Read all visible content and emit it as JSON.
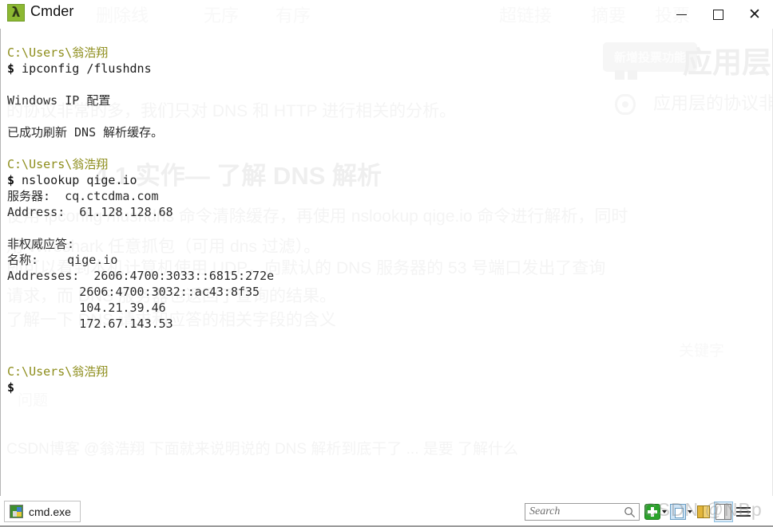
{
  "window": {
    "title": "Cmder",
    "app_icon": "lambda-icon",
    "controls": {
      "minimize": "minimize-icon",
      "maximize": "maximize-icon",
      "close": "close-icon"
    }
  },
  "terminal": {
    "lines": [
      {
        "type": "prompt",
        "text": "C:\\Users\\翁浩翔"
      },
      {
        "type": "command",
        "sigil": "$",
        "text": " ipconfig /flushdns"
      },
      {
        "type": "blank",
        "text": ""
      },
      {
        "type": "output",
        "text": "Windows IP 配置"
      },
      {
        "type": "blank",
        "text": ""
      },
      {
        "type": "output",
        "text": "已成功刷新 DNS 解析缓存。"
      },
      {
        "type": "blank",
        "text": ""
      },
      {
        "type": "prompt",
        "text": "C:\\Users\\翁浩翔"
      },
      {
        "type": "command",
        "sigil": "$",
        "text": " nslookup qige.io"
      },
      {
        "type": "output",
        "text": "服务器:  cq.ctcdma.com"
      },
      {
        "type": "output",
        "text": "Address:  61.128.128.68"
      },
      {
        "type": "blank",
        "text": ""
      },
      {
        "type": "output",
        "text": "非权威应答:"
      },
      {
        "type": "output",
        "text": "名称:    qige.io"
      },
      {
        "type": "output",
        "text": "Addresses:  2606:4700:3033::6815:272e"
      },
      {
        "type": "output",
        "text": "          2606:4700:3032::ac43:8f35"
      },
      {
        "type": "output",
        "text": "          104.21.39.46"
      },
      {
        "type": "output",
        "text": "          172.67.143.53"
      },
      {
        "type": "blank",
        "text": ""
      },
      {
        "type": "blank",
        "text": ""
      },
      {
        "type": "prompt",
        "text": "C:\\Users\\翁浩翔"
      },
      {
        "type": "command",
        "sigil": "$",
        "text": ""
      }
    ],
    "colors": {
      "prompt": "#8d8d1b",
      "sigil": "#0b0b0b",
      "command": "#1b1b1b",
      "output": "#2a2a2a",
      "background": "#ffffff"
    }
  },
  "statusbar": {
    "tab": {
      "label": "cmd.exe",
      "icon": "console-icon"
    },
    "search": {
      "placeholder": "Search",
      "value": "",
      "icon": "search-icon"
    },
    "tools": [
      {
        "name": "new-console-button",
        "icon": "green-plus-icon",
        "has_caret": true
      },
      {
        "name": "copy-paste-button",
        "icon": "page-icon",
        "has_caret": true
      },
      {
        "name": "lock-button",
        "icon": "lock-icon",
        "has_caret": false
      },
      {
        "name": "toggle-panel-button",
        "icon": "panel-icon",
        "has_caret": false
      },
      {
        "name": "menu-button",
        "icon": "hamburger-menu-icon",
        "has_caret": false
      }
    ],
    "watermark": "CSDN @NBp"
  },
  "background_bleed": {
    "chip": "新增投票功能",
    "toolbar_labels": [
      "删除线",
      "无序",
      "有序",
      "超链接",
      "摘要",
      "投票"
    ],
    "heading_partial": "应用层",
    "subtext_partial": "应用层的协议非常",
    "heading_41": "4.1 实作— 了解 DNS 解析",
    "line_a": "的协议非常的多，我们只对 DNS 和 HTTP 进行相关的分析。",
    "line_b": "使用 ipconfig /flushdns 命令清除缓存，再使用 nslookup qige.io 命令进行解析，同时",
    "line_c": "用 Wireshark 任意抓包（可用 dns 过滤）。",
    "line_d": "即可以看到本机计算机使用 UDP，向默认的 DNS 服务器的 53 号端口发出了查询",
    "line_e": "请求，而 DNS 服务器也返回了查询的结果。",
    "line_f": "了解一下 DNS 请求和应答的相关字段的含义",
    "line_g": "CSDN博客 @翁浩翔  下面就来说明说的 DNS 解析到底干了 ...  是要  了解什么",
    "sidebar_hint": "关键字",
    "sidebar_hint2": "问题"
  }
}
